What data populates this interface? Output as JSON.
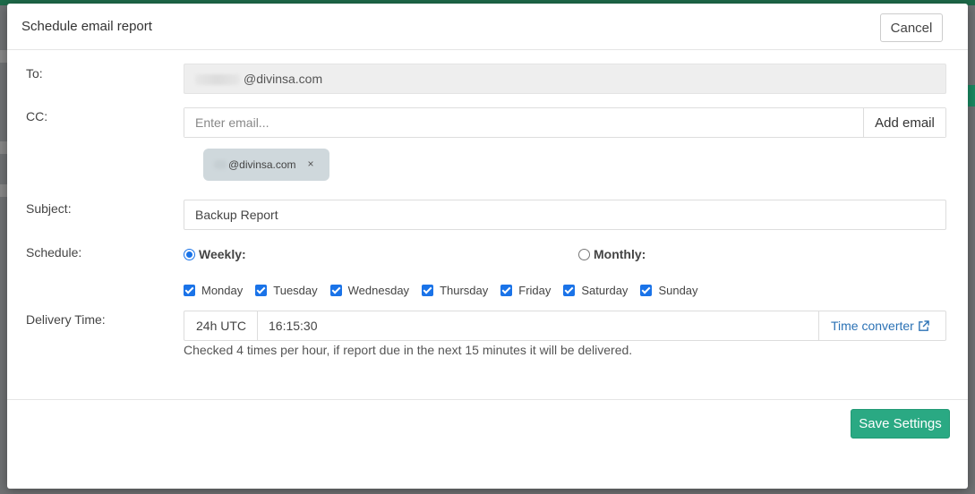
{
  "modal": {
    "title": "Schedule email report",
    "cancel_label": "Cancel",
    "save_label": "Save Settings"
  },
  "form": {
    "to_label": "To:",
    "to_value": "@divinsa.com",
    "cc_label": "CC:",
    "cc_placeholder": "Enter email...",
    "add_email_label": "Add email",
    "cc_chips": [
      {
        "email": "@divinsa.com",
        "remove_symbol": "×"
      }
    ],
    "subject_label": "Subject:",
    "subject_value": "Backup Report",
    "schedule_label": "Schedule:",
    "schedule_options": [
      {
        "label": "Weekly:",
        "checked": true
      },
      {
        "label": "Monthly:",
        "checked": false
      }
    ],
    "days": [
      {
        "label": "Monday",
        "checked": true
      },
      {
        "label": "Tuesday",
        "checked": true
      },
      {
        "label": "Wednesday",
        "checked": true
      },
      {
        "label": "Thursday",
        "checked": true
      },
      {
        "label": "Friday",
        "checked": true
      },
      {
        "label": "Saturday",
        "checked": true
      },
      {
        "label": "Sunday",
        "checked": true
      }
    ],
    "delivery_label": "Delivery Time:",
    "timezone": "24h UTC",
    "time_value": "16:15:30",
    "time_converter_label": "Time converter",
    "time_converter_icon": "external-link-icon",
    "help_text": "Checked 4 times per hour, if report due in the next 15 minutes it will be delivered."
  },
  "colors": {
    "accent": "#2aa983",
    "link": "#2b72b5",
    "checkbox": "#1a73e8"
  }
}
